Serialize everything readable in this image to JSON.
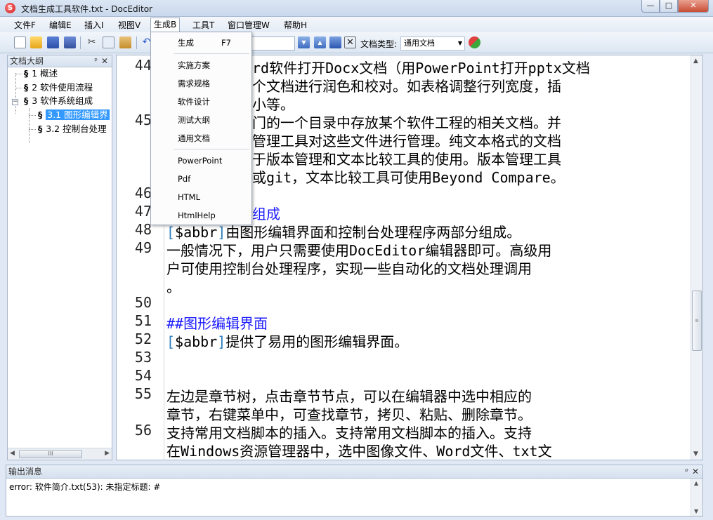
{
  "window": {
    "title": "文档生成工具软件.txt - DocEditor",
    "app_icon": "S",
    "minimize_glyph": "—",
    "maximize_glyph": "□",
    "close_glyph": "✕"
  },
  "menubar": {
    "items": [
      "文件F",
      "编辑E",
      "插入I",
      "视图V",
      "生成B",
      "工具T",
      "窗口管理W",
      "帮助H"
    ],
    "active": "生成B"
  },
  "toolbar": {
    "doc_type_label": "文档类型:",
    "doc_type_value": "通用文档",
    "icons": [
      "new-file-icon",
      "open-folder-icon",
      "save-icon",
      "save-all-icon",
      "cut-icon",
      "copy-icon",
      "paste-icon",
      "undo-icon",
      "generate-icon",
      "find-prev-icon",
      "find-next-icon",
      "edit-icon",
      "clear-icon",
      "refresh-icon"
    ]
  },
  "outline": {
    "title": "文档大纲",
    "pin_glyph": "ᵖ",
    "close_glyph": "✕",
    "section_glyph": "§",
    "expander_glyph": "−",
    "nodes": [
      {
        "label": "1 概述",
        "level": 0
      },
      {
        "label": "2 软件使用流程",
        "level": 0
      },
      {
        "label": "3 软件系统组成",
        "level": 0
      },
      {
        "label": "3.1 图形编辑界",
        "level": 1
      },
      {
        "label": "3.2 控制台处理",
        "level": 1
      }
    ],
    "selected_index": 3
  },
  "dropdown": {
    "items": [
      {
        "label": "生成",
        "shortcut": "F7"
      },
      {
        "label": "实施方案"
      },
      {
        "label": "需求规格"
      },
      {
        "label": "软件设计"
      },
      {
        "label": "测试大纲"
      },
      {
        "label": "通用文档"
      },
      {
        "label": "PowerPoint"
      },
      {
        "label": "Pdf"
      },
      {
        "label": "HTML"
      },
      {
        "label": "HtmlHelp"
      }
    ]
  },
  "editor": {
    "abbr_token": "$abbr",
    "lines": [
      {
        "num": "44",
        "text": "rd软件打开Docx文档（用PowerPoint打开pptx文档",
        "indent": 192
      },
      {
        "num": "",
        "text": "个文档进行润色和校对。如表格调整行列宽度，插",
        "indent": 192
      },
      {
        "num": "",
        "text": "小等。",
        "indent": 192
      },
      {
        "num": "45",
        "text": "门的一个目录中存放某个软件工程的相关文档。并",
        "indent": 192
      },
      {
        "num": "",
        "text": "管理工具对这些文件进行管理。纯文本格式的文档",
        "indent": 192
      },
      {
        "num": "",
        "text": "于版本管理和文本比较工具的使用。版本管理工具",
        "indent": 192
      },
      {
        "num": "",
        "text": "或git，文本比较工具可使用Beyond Compare。",
        "indent": 192
      },
      {
        "num": "46",
        "text": "",
        "indent": 0
      },
      {
        "num": "47",
        "text": "组成",
        "indent": 192,
        "heading": true
      },
      {
        "num": "48",
        "text": "由图形编辑界面和控制台处理程序两部分组成。",
        "indent": 0,
        "abbr": true
      },
      {
        "num": "49",
        "text": "一般情况下，用户只需要使用DocEditor编辑器即可。高级用",
        "indent": 0
      },
      {
        "num": "",
        "text": "户可使用控制台处理程序，实现一些自动化的文档处理调用",
        "indent": 0
      },
      {
        "num": "",
        "text": "。",
        "indent": 0
      },
      {
        "num": "50",
        "text": "",
        "indent": 0
      },
      {
        "num": "51",
        "text": "##图形编辑界面",
        "indent": 0,
        "heading": true
      },
      {
        "num": "52",
        "text": "提供了易用的图形编辑界面。",
        "indent": 0,
        "abbr": true
      },
      {
        "num": "53",
        "text": "",
        "indent": 0
      },
      {
        "num": "54",
        "text": "",
        "indent": 0
      },
      {
        "num": "55",
        "text": "左边是章节树，点击章节节点，可以在编辑器中选中相应的",
        "indent": 0
      },
      {
        "num": "",
        "text": "章节，右键菜单中，可查找章节，拷贝、粘贴、删除章节。",
        "indent": 0
      },
      {
        "num": "56",
        "text": "支持常用文档脚本的插入。支持常用文档脚本的插入。支持",
        "indent": 0
      },
      {
        "num": "",
        "text": "在Windows资源管理器中，选中图像文件、Word文件、txt文",
        "indent": 0
      }
    ]
  },
  "output": {
    "title": "输出消息",
    "pin_glyph": "ᵖ",
    "close_glyph": "✕",
    "message": "error: 软件简介.txt(53): 未指定标题: #"
  },
  "scrollbars": {
    "up": "▲",
    "down": "▼",
    "left": "◀",
    "right": "▶",
    "grip_v": "≡",
    "grip_h": "III"
  }
}
